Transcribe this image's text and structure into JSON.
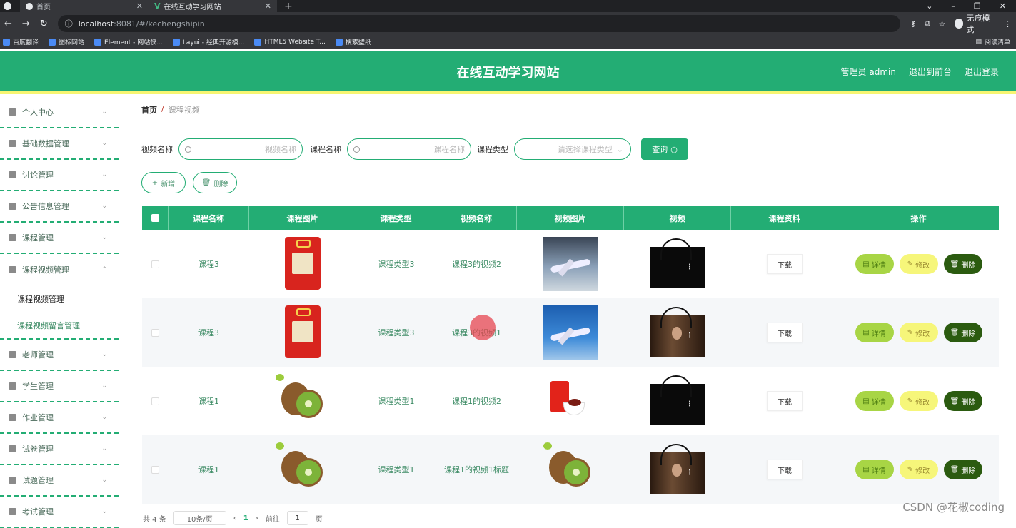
{
  "browser": {
    "tabs": [
      {
        "label": "首页"
      },
      {
        "label": "在线互动学习网站"
      }
    ],
    "address": {
      "host": "localhost",
      "path": ":8081/#/kechengshipin"
    },
    "incognito_label": "无痕模式",
    "bookmarks": [
      "百度翻译",
      "图标网站",
      "Element - 网站快...",
      "Layui - 经典开源模...",
      "HTML5 Website T...",
      "搜索壁纸"
    ],
    "reading_list": "阅读清单"
  },
  "header": {
    "title": "在线互动学习网站",
    "user": "管理员 admin",
    "back_front": "退出到前台",
    "logout": "退出登录"
  },
  "sidebar": {
    "items": [
      {
        "label": "个人中心",
        "icon": "user-icon"
      },
      {
        "label": "基础数据管理",
        "icon": "user-icon"
      },
      {
        "label": "讨论管理",
        "icon": "grid-icon"
      },
      {
        "label": "公告信息管理",
        "icon": "copy-icon"
      },
      {
        "label": "课程管理",
        "icon": "flag-icon"
      },
      {
        "label": "课程视频管理",
        "icon": "circle-icon"
      }
    ],
    "sub": [
      "课程视频管理",
      "课程视频留言管理"
    ],
    "items2": [
      {
        "label": "老师管理",
        "icon": "card-icon"
      },
      {
        "label": "学生管理",
        "icon": "briefcase-icon"
      },
      {
        "label": "作业管理",
        "icon": "frame-icon"
      },
      {
        "label": "试卷管理",
        "icon": "clipboard-icon"
      },
      {
        "label": "试题管理",
        "icon": "list-icon"
      },
      {
        "label": "考试管理",
        "icon": "scissors-icon"
      }
    ]
  },
  "breadcrumb": {
    "home": "首页",
    "sep": "/",
    "current": "课程视频"
  },
  "search": {
    "video_label": "视频名称",
    "video_placeholder": "视频名称",
    "course_label": "课程名称",
    "course_placeholder": "课程名称",
    "type_label": "课程类型",
    "type_placeholder": "请选择课程类型",
    "query": "查询"
  },
  "actions": {
    "add": "新增",
    "delete": "删除"
  },
  "table": {
    "headers": [
      "课程名称",
      "课程图片",
      "课程类型",
      "视频名称",
      "视频图片",
      "视频",
      "课程资料",
      "操作"
    ],
    "rows": [
      {
        "course": "课程3",
        "type": "课程类型3",
        "video_name": "课程3的视频2",
        "download": "下载"
      },
      {
        "course": "课程3",
        "type": "课程类型3",
        "video_name": "课程3的视频1",
        "download": "下载"
      },
      {
        "course": "课程1",
        "type": "课程类型1",
        "video_name": "课程1的视频2",
        "download": "下载"
      },
      {
        "course": "课程1",
        "type": "课程类型1",
        "video_name": "课程1的视频1标题",
        "download": "下载"
      }
    ],
    "op_detail": "详情",
    "op_edit": "修改",
    "op_delete": "删除"
  },
  "pager": {
    "total": "共 4 条",
    "size": "10条/页",
    "prev": "‹",
    "page": "1",
    "next": "›",
    "goto": "前往",
    "goto_page": "1",
    "unit": "页"
  },
  "watermark": "CSDN @花椒coding",
  "colors": {
    "accent": "#23ad74",
    "highlight": "#f7f572"
  }
}
